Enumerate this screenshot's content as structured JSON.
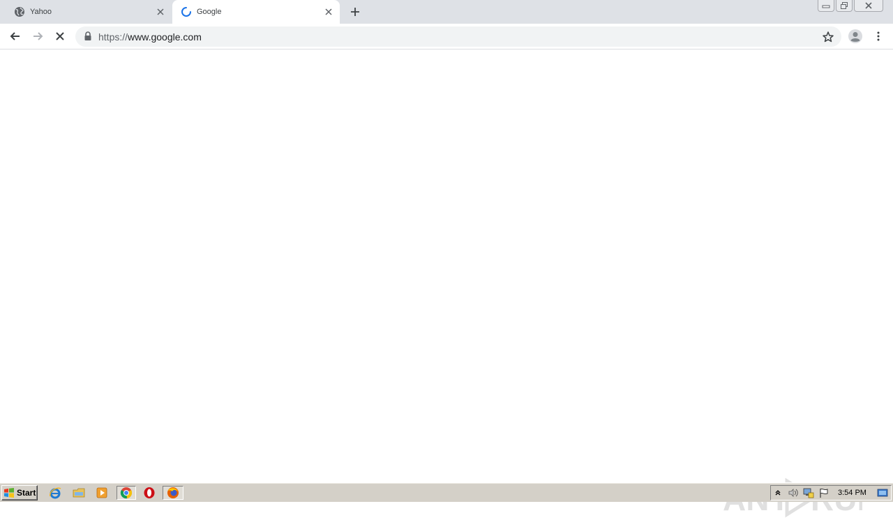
{
  "tabs": [
    {
      "title": "Yahoo",
      "favicon": "globe-icon",
      "active": false
    },
    {
      "title": "Google",
      "favicon": "loading-spinner-icon",
      "active": true
    }
  ],
  "omnibox": {
    "url_scheme": "https://",
    "url_host": "www.google.com"
  },
  "toolbar_icons": [
    "back-arrow-icon",
    "forward-arrow-icon",
    "stop-loading-icon",
    "lock-icon",
    "bookmark-star-icon",
    "profile-avatar-icon",
    "kebab-menu-icon"
  ],
  "window_controls": [
    "minimize-icon",
    "restore-icon",
    "close-icon"
  ],
  "watermark": {
    "text": "ANY RUN"
  },
  "taskbar": {
    "start_label": "Start",
    "quick_launch": [
      "internet-explorer-icon",
      "file-explorer-icon",
      "media-player-icon",
      "chrome-icon",
      "opera-icon",
      "firefox-icon"
    ],
    "tray_icons": [
      "show-hidden-icons-chevron",
      "volume-icon",
      "network-icon",
      "action-center-flag-icon"
    ],
    "clock": "3:54 PM"
  },
  "colors": {
    "tabstrip": "#dee1e6",
    "omnibox": "#f1f3f4",
    "spinner": "#1a73e8",
    "taskbar": "#d4d0c8"
  }
}
